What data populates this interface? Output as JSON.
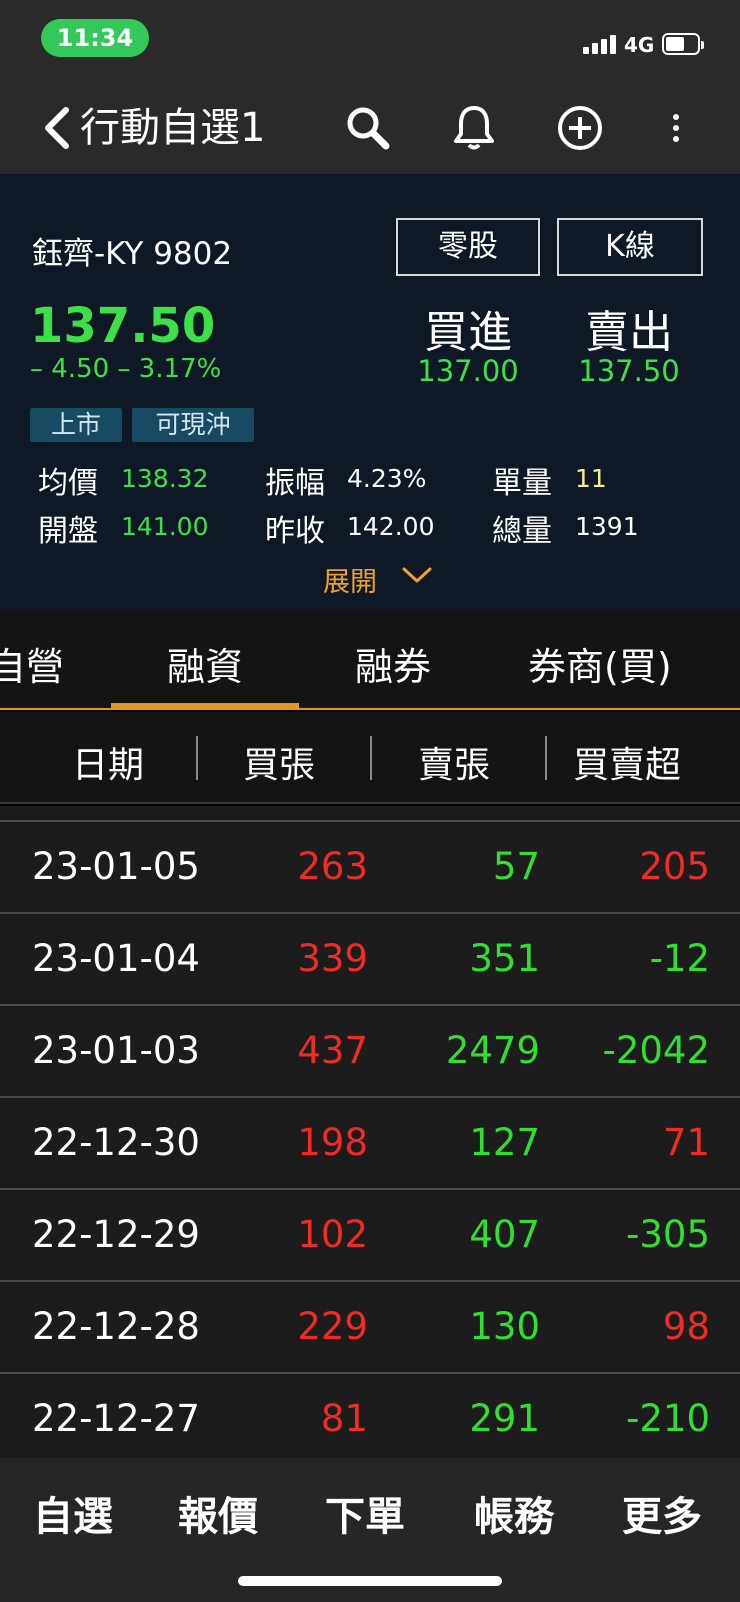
{
  "status_bar": {
    "time": "11:34",
    "network": "4G"
  },
  "nav": {
    "title": "行動自選1"
  },
  "quote": {
    "name": "鈺齊-KY 9802",
    "odd_lot_label": "零股",
    "kline_label": "K線",
    "price": "137.50",
    "change": "– 4.50  – 3.17%",
    "bid_label": "買進",
    "ask_label": "賣出",
    "bid": "137.00",
    "ask": "137.50",
    "tags": [
      "上市",
      "可現沖"
    ],
    "stats": [
      {
        "label": "均價",
        "value": "138.32",
        "color": "#3ee04a"
      },
      {
        "label": "振幅",
        "value": "4.23%",
        "color": "#ffffff"
      },
      {
        "label": "單量",
        "value": "11",
        "color": "#f4ef8a"
      },
      {
        "label": "開盤",
        "value": "141.00",
        "color": "#3ee04a"
      },
      {
        "label": "昨收",
        "value": "142.00",
        "color": "#ffffff"
      },
      {
        "label": "總量",
        "value": "1391",
        "color": "#ffffff"
      }
    ],
    "expand_label": "展開"
  },
  "tabs": [
    "自營",
    "融資",
    "融券",
    "券商(買)"
  ],
  "active_tab": "融資",
  "columns": [
    "日期",
    "買張",
    "賣張",
    "買賣超"
  ],
  "rows": [
    {
      "date": "23-01-05",
      "buy": "263",
      "sell": "57",
      "net": "205"
    },
    {
      "date": "23-01-04",
      "buy": "339",
      "sell": "351",
      "net": "-12"
    },
    {
      "date": "23-01-03",
      "buy": "437",
      "sell": "2479",
      "net": "-2042"
    },
    {
      "date": "22-12-30",
      "buy": "198",
      "sell": "127",
      "net": "71"
    },
    {
      "date": "22-12-29",
      "buy": "102",
      "sell": "407",
      "net": "-305"
    },
    {
      "date": "22-12-28",
      "buy": "229",
      "sell": "130",
      "net": "98"
    },
    {
      "date": "22-12-27",
      "buy": "81",
      "sell": "291",
      "net": "-210"
    }
  ],
  "colors": {
    "up": "#f02a24",
    "down": "#2fe02f",
    "accent": "#e39623"
  },
  "bottom_nav": [
    "自選",
    "報價",
    "下單",
    "帳務",
    "更多"
  ]
}
